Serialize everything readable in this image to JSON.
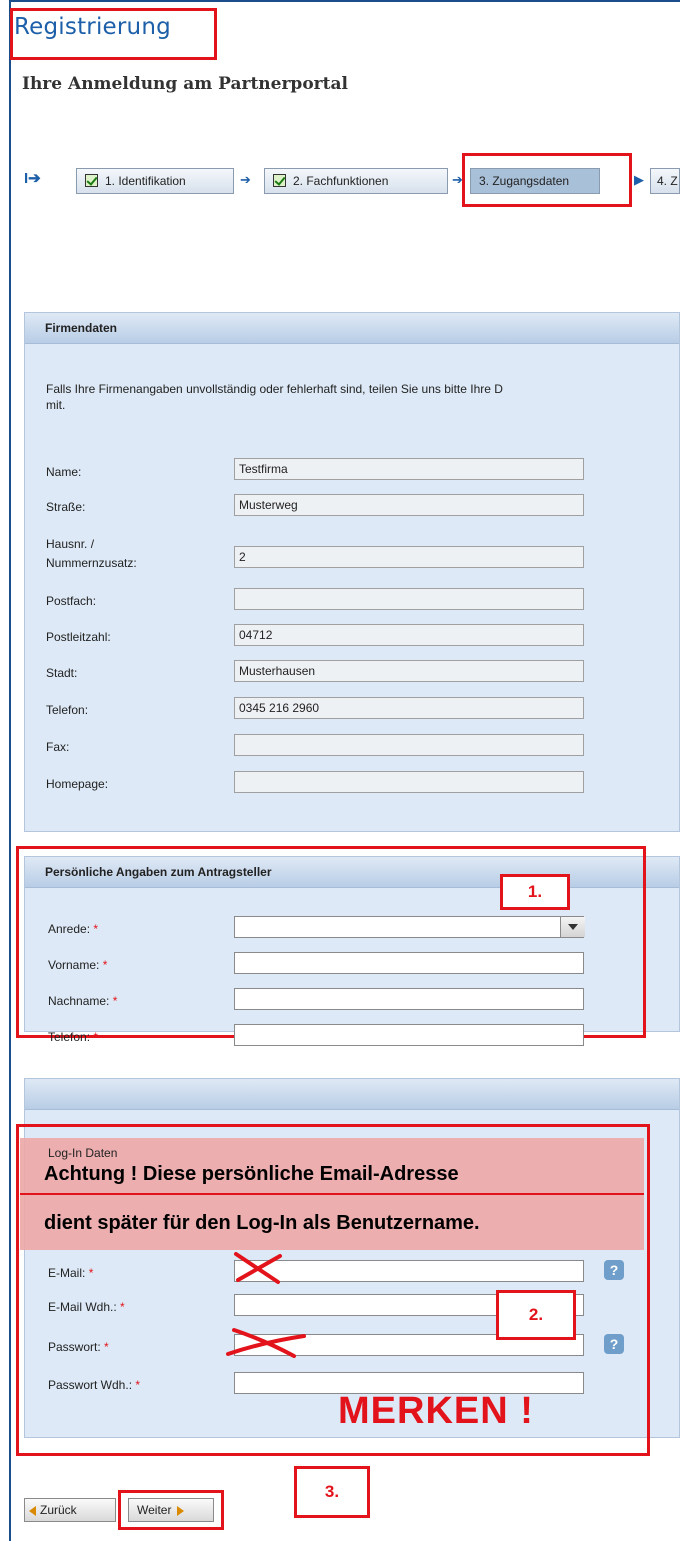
{
  "header": {
    "title": "Registrierung",
    "subtitle": "Ihre Anmeldung am Partnerportal"
  },
  "steps": [
    {
      "label": "1. Identifikation",
      "done": true
    },
    {
      "label": "2. Fachfunktionen",
      "done": true
    },
    {
      "label": "3. Zugangsdaten",
      "active": true
    },
    {
      "label": "4. Z"
    }
  ],
  "firmendaten": {
    "heading": "Firmendaten",
    "info": "Falls Ihre Firmenangaben unvollständig oder fehlerhaft sind, teilen Sie uns bitte Ihre D",
    "info2": "mit.",
    "fields": [
      {
        "label": "Name:",
        "value": "Testfirma"
      },
      {
        "label": "Straße:",
        "value": "Musterweg"
      },
      {
        "label": "Hausnr. /",
        "label2": "Nummernzusatz:",
        "value": "2"
      },
      {
        "label": "Postfach:",
        "value": ""
      },
      {
        "label": "Postleitzahl:",
        "value": "04712"
      },
      {
        "label": "Stadt:",
        "value": "Musterhausen"
      },
      {
        "label": "Telefon:",
        "value": "0345 216 2960"
      },
      {
        "label": "Fax:",
        "value": ""
      },
      {
        "label": "Homepage:",
        "value": ""
      }
    ]
  },
  "persoenlich": {
    "heading": "Persönliche Angaben zum Antragsteller",
    "fields": [
      {
        "label": "Anrede:",
        "value": ""
      },
      {
        "label": "Vorname:",
        "value": ""
      },
      {
        "label": "Nachname:",
        "value": ""
      },
      {
        "label": "Telefon:",
        "value": ""
      }
    ],
    "required_mark": "*"
  },
  "login": {
    "heading": "Log-In Daten",
    "warning_line1": "Achtung ! Diese persönliche Email-Adresse",
    "warning_line2": "dient später für den Log-In als Benutzername.",
    "fields": [
      {
        "label": "E-Mail:",
        "value": ""
      },
      {
        "label": "E-Mail Wdh.:",
        "value": ""
      },
      {
        "label": "Passwort:",
        "value": ""
      },
      {
        "label": "Passwort Wdh.:",
        "value": ""
      }
    ],
    "help_glyph": "?",
    "merken": "MERKEN !"
  },
  "annotations": {
    "one": "1.",
    "two": "2.",
    "three": "3."
  },
  "nav": {
    "back": "Zurück",
    "next": "Weiter"
  },
  "icons": {
    "arrow": "arrow-right-icon",
    "help": "help-icon",
    "check": "checkbox-checked-icon"
  },
  "colors": {
    "accent": "#1d5fa8",
    "highlight": "#e3131b",
    "panel": "#dde9f6"
  }
}
